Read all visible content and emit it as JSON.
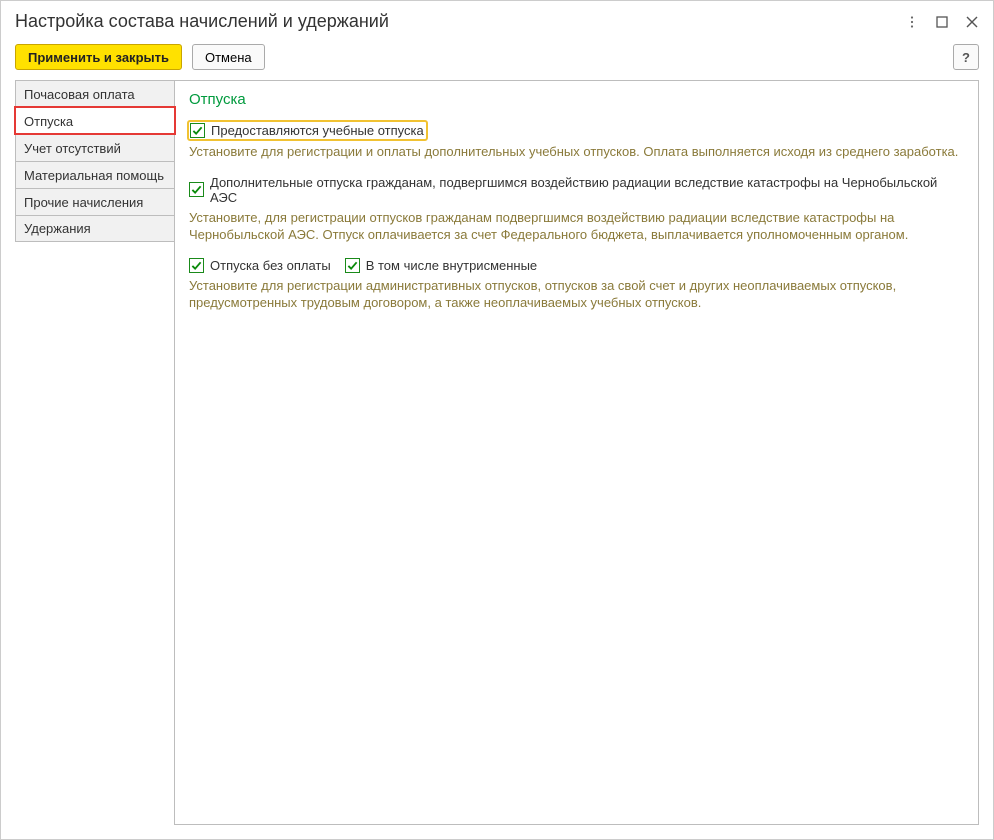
{
  "window": {
    "title": "Настройка состава начислений и удержаний"
  },
  "toolbar": {
    "apply_close": "Применить и закрыть",
    "cancel": "Отмена",
    "help": "?"
  },
  "sidebar": {
    "items": [
      {
        "label": "Почасовая оплата",
        "active": false
      },
      {
        "label": "Отпуска",
        "active": true
      },
      {
        "label": "Учет отсутствий",
        "active": false
      },
      {
        "label": "Материальная помощь",
        "active": false
      },
      {
        "label": "Прочие начисления",
        "active": false
      },
      {
        "label": "Удержания",
        "active": false
      }
    ]
  },
  "content": {
    "title": "Отпуска",
    "options": {
      "study": {
        "label": "Предоставляются учебные отпуска",
        "checked": true,
        "highlight": true,
        "hint": "Установите для регистрации и оплаты дополнительных учебных отпусков. Оплата выполняется исходя из среднего заработка."
      },
      "chernobyl": {
        "label": "Дополнительные отпуска гражданам, подвергшимся воздействию радиации вследствие катастрофы на Чернобыльской АЭС",
        "checked": true,
        "hint": "Установите, для регистрации отпусков гражданам подвергшимся воздействию радиации вследствие катастрофы на Чернобыльской АЭС. Отпуск оплачивается за счет Федерального бюджета, выплачивается уполномоченным органом."
      },
      "unpaid": {
        "label": "Отпуска без оплаты",
        "checked": true
      },
      "unpaid_inshift": {
        "label": "В том числе внутрисменные",
        "checked": true
      },
      "unpaid_hint": "Установите для регистрации административных отпусков, отпусков за свой счет и других неоплачиваемых отпусков, предусмотренных трудовым договором, а также неоплачиваемых учебных отпусков."
    }
  }
}
